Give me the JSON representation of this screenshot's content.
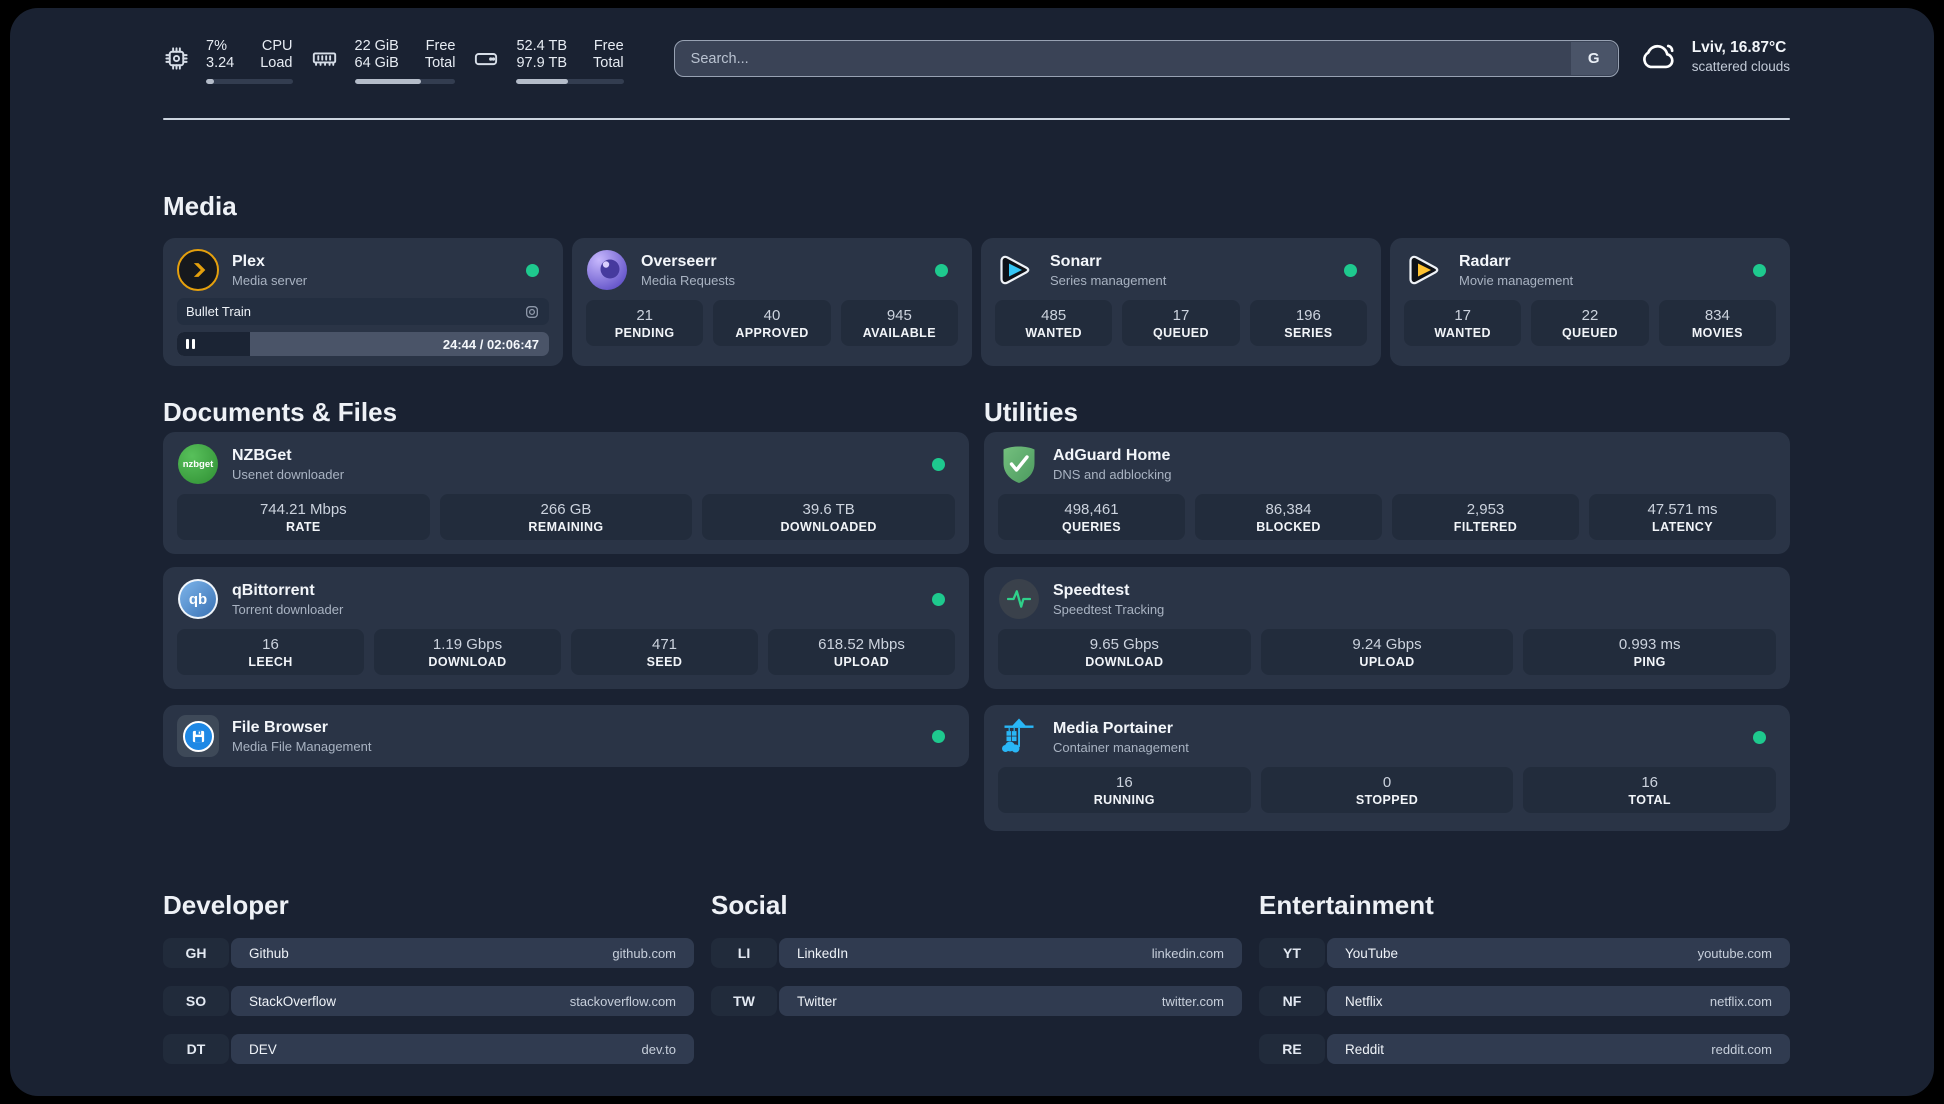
{
  "header": {
    "cpu": {
      "percent": "7%",
      "load": "3.24",
      "label_top": "CPU",
      "label_bottom": "Load",
      "progress_pct": 9
    },
    "memory": {
      "free": "22 GiB",
      "total": "64 GiB",
      "label_top": "Free",
      "label_bottom": "Total",
      "progress_pct": 66
    },
    "storage": {
      "free": "52.4 TB",
      "total": "97.9 TB",
      "label_top": "Free",
      "label_bottom": "Total",
      "progress_pct": 48
    },
    "search": {
      "placeholder": "Search...",
      "provider_button": "G"
    },
    "weather": {
      "location": "Lviv, 16.87°C",
      "condition": "scattered clouds"
    }
  },
  "sections": {
    "media": "Media",
    "documents": "Documents & Files",
    "utilities": "Utilities",
    "developer": "Developer",
    "social": "Social",
    "entertainment": "Entertainment"
  },
  "apps": {
    "plex": {
      "name": "Plex",
      "description": "Media server",
      "online": true,
      "now_playing": {
        "title": "Bullet Train",
        "time": "24:44 / 02:06:47",
        "progress_pct": 19.5
      }
    },
    "overseerr": {
      "name": "Overseerr",
      "description": "Media Requests",
      "online": true,
      "stats": [
        {
          "value": "21",
          "label": "PENDING"
        },
        {
          "value": "40",
          "label": "APPROVED"
        },
        {
          "value": "945",
          "label": "AVAILABLE"
        }
      ]
    },
    "sonarr": {
      "name": "Sonarr",
      "description": "Series management",
      "online": true,
      "stats": [
        {
          "value": "485",
          "label": "WANTED"
        },
        {
          "value": "17",
          "label": "QUEUED"
        },
        {
          "value": "196",
          "label": "SERIES"
        }
      ]
    },
    "radarr": {
      "name": "Radarr",
      "description": "Movie management",
      "online": true,
      "stats": [
        {
          "value": "17",
          "label": "WANTED"
        },
        {
          "value": "22",
          "label": "QUEUED"
        },
        {
          "value": "834",
          "label": "MOVIES"
        }
      ]
    },
    "nzbget": {
      "name": "NZBGet",
      "description": "Usenet downloader",
      "online": true,
      "stats": [
        {
          "value": "744.21 Mbps",
          "label": "RATE"
        },
        {
          "value": "266 GB",
          "label": "REMAINING"
        },
        {
          "value": "39.6 TB",
          "label": "DOWNLOADED"
        }
      ]
    },
    "qbittorrent": {
      "name": "qBittorrent",
      "description": "Torrent downloader",
      "online": true,
      "stats": [
        {
          "value": "16",
          "label": "LEECH"
        },
        {
          "value": "1.19 Gbps",
          "label": "DOWNLOAD"
        },
        {
          "value": "471",
          "label": "SEED"
        },
        {
          "value": "618.52 Mbps",
          "label": "UPLOAD"
        }
      ]
    },
    "filebrowser": {
      "name": "File Browser",
      "description": "Media File Management",
      "online": true
    },
    "adguard": {
      "name": "AdGuard Home",
      "description": "DNS and adblocking",
      "stats": [
        {
          "value": "498,461",
          "label": "QUERIES"
        },
        {
          "value": "86,384",
          "label": "BLOCKED"
        },
        {
          "value": "2,953",
          "label": "FILTERED"
        },
        {
          "value": "47.571 ms",
          "label": "LATENCY"
        }
      ]
    },
    "speedtest": {
      "name": "Speedtest",
      "description": "Speedtest Tracking",
      "stats": [
        {
          "value": "9.65 Gbps",
          "label": "DOWNLOAD"
        },
        {
          "value": "9.24 Gbps",
          "label": "UPLOAD"
        },
        {
          "value": "0.993 ms",
          "label": "PING"
        }
      ]
    },
    "portainer": {
      "name": "Media Portainer",
      "description": "Container management",
      "online": true,
      "stats": [
        {
          "value": "16",
          "label": "RUNNING"
        },
        {
          "value": "0",
          "label": "STOPPED"
        },
        {
          "value": "16",
          "label": "TOTAL"
        }
      ]
    }
  },
  "links": {
    "developer": [
      {
        "abbr": "GH",
        "name": "Github",
        "url": "github.com"
      },
      {
        "abbr": "SO",
        "name": "StackOverflow",
        "url": "stackoverflow.com"
      },
      {
        "abbr": "DT",
        "name": "DEV",
        "url": "dev.to"
      }
    ],
    "social": [
      {
        "abbr": "LI",
        "name": "LinkedIn",
        "url": "linkedin.com"
      },
      {
        "abbr": "TW",
        "name": "Twitter",
        "url": "twitter.com"
      }
    ],
    "entertainment": [
      {
        "abbr": "YT",
        "name": "YouTube",
        "url": "youtube.com"
      },
      {
        "abbr": "NF",
        "name": "Netflix",
        "url": "netflix.com"
      },
      {
        "abbr": "RE",
        "name": "Reddit",
        "url": "reddit.com"
      }
    ]
  },
  "colors": {
    "background": "#1a2232",
    "card": "#2a3446",
    "status_online": "#1ec98e",
    "plex_orange": "#e5a00d",
    "sonarr_blue": "#35c5f4",
    "radarr_yellow": "#ffc230",
    "nzbget_green": "#3eaa3e",
    "adguard_green": "#67b279",
    "qbittorrent_blue": "#4a90d9",
    "speedtest_green": "#2fd08a",
    "portainer_blue": "#29b6f6",
    "filebrowser_blue": "#1e88e5"
  }
}
